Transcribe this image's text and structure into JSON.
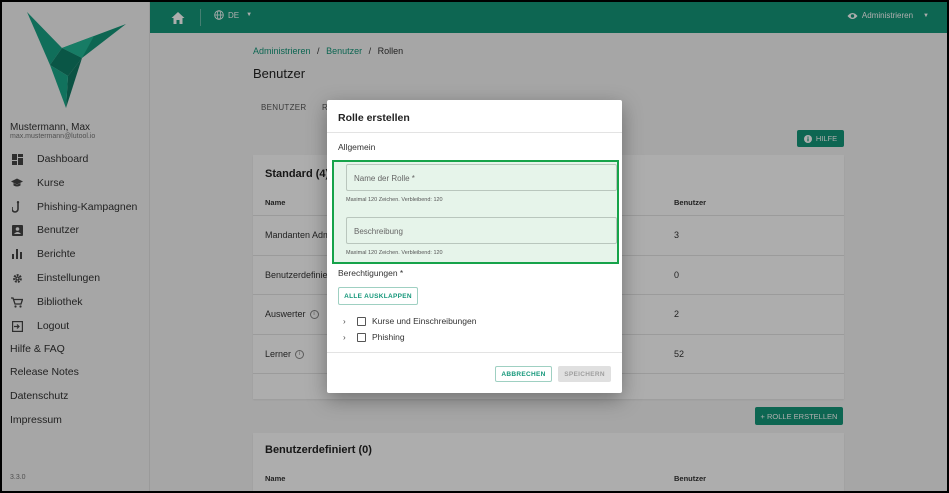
{
  "sidebar": {
    "user_name": "Mustermann, Max",
    "user_email": "max.mustermann@lutool.io",
    "items": [
      {
        "label": "Dashboard",
        "icon": "dashboard-icon"
      },
      {
        "label": "Kurse",
        "icon": "graduation-cap-icon"
      },
      {
        "label": "Phishing-Kampagnen",
        "icon": "phishing-hook-icon"
      },
      {
        "label": "Benutzer",
        "icon": "user-badge-icon"
      },
      {
        "label": "Berichte",
        "icon": "bar-chart-icon"
      },
      {
        "label": "Einstellungen",
        "icon": "gear-icon"
      },
      {
        "label": "Bibliothek",
        "icon": "cart-icon"
      },
      {
        "label": "Logout",
        "icon": "logout-icon"
      }
    ],
    "links": [
      "Hilfe & FAQ",
      "Release Notes",
      "Datenschutz",
      "Impressum"
    ],
    "version": "3.3.0"
  },
  "topbar": {
    "language": "DE",
    "admin_label": "Administrieren"
  },
  "breadcrumb": {
    "items": [
      "Administrieren",
      "Benutzer",
      "Rollen"
    ],
    "separator": "/"
  },
  "page": {
    "title": "Benutzer",
    "tabs": [
      "BENUTZER",
      "R"
    ],
    "help_button": "HILFE"
  },
  "standard_card": {
    "title": "Standard (4)",
    "col_name": "Name",
    "col_users": "Benutzer",
    "rows": [
      {
        "name": "Mandanten Admin",
        "users": "3",
        "info": false
      },
      {
        "name": "Benutzerdefiniert",
        "users": "0",
        "info": false
      },
      {
        "name": "Auswerter",
        "users": "2",
        "info": true
      },
      {
        "name": "Lerner",
        "users": "52",
        "info": true
      }
    ]
  },
  "create_role_button": "+ ROLLE ERSTELLEN",
  "custom_card": {
    "title": "Benutzerdefiniert (0)",
    "col_name": "Name",
    "col_users": "Benutzer"
  },
  "dialog": {
    "title": "Rolle erstellen",
    "section_general": "Allgemein",
    "name_field": {
      "placeholder": "Name der Rolle *",
      "value": "",
      "hint": "Maximal 120 Zeichen. Verbleibend: 120"
    },
    "description_field": {
      "placeholder": "Beschreibung",
      "value": "",
      "hint": "Maximal 120 Zeichen. Verbleibend: 120"
    },
    "permissions_label": "Berechtigungen *",
    "expand_all_button": "ALLE AUSKLAPPEN",
    "permissions": [
      {
        "label": "Kurse und Einschreibungen",
        "checked": false
      },
      {
        "label": "Phishing",
        "checked": false
      }
    ],
    "cancel_button": "ABBRECHEN",
    "save_button": "SPEICHERN"
  },
  "colors": {
    "brand": "#14977a",
    "highlight_border": "#16a34a",
    "highlight_fill": "#e6f4ea"
  }
}
